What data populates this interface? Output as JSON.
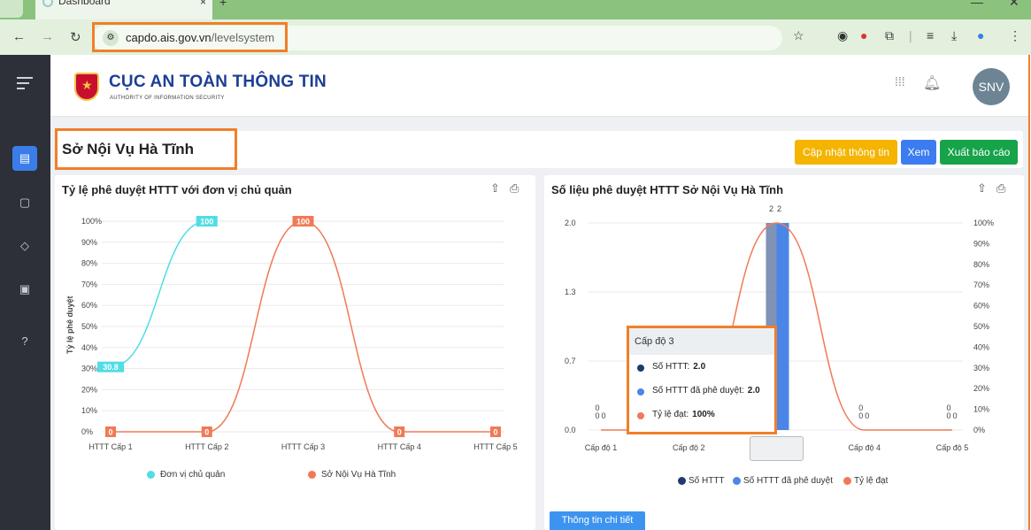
{
  "browser": {
    "tab_title": "Dashboard",
    "tab_close": "×",
    "new_tab": "+",
    "url_host": "capdo.ais.gov.vn",
    "url_path": "/levelsystem"
  },
  "header": {
    "org_name": "CỤC AN TOÀN THÔNG TIN",
    "org_sub": "AUTHORITY OF INFORMATION SECURITY",
    "avatar": "SNV"
  },
  "page": {
    "title": "Sở Nội Vụ Hà Tĩnh",
    "buttons": {
      "update": "Cập nhật thông tin",
      "view": "Xem",
      "export": "Xuất báo cáo"
    },
    "detail_button": "Thông tin chi tiết"
  },
  "left_chart_title": "Tỷ lệ phê duyệt HTTT với đơn vị chủ quản",
  "right_chart_title": "Số liệu phê duyệt HTTT Sở Nội Vụ Hà Tĩnh",
  "tooltip": {
    "title": "Cấp độ 3",
    "rows": [
      {
        "label": "Số HTTT:",
        "value": "2.0"
      },
      {
        "label": "Số HTTT đã phê duyệt:",
        "value": "2.0"
      },
      {
        "label": "Tỷ lệ đạt:",
        "value": "100%"
      }
    ]
  },
  "chart_data": [
    {
      "type": "line",
      "title": "Tỷ lệ phê duyệt HTTT với đơn vị chủ quản",
      "ylabel": "Tỷ lệ phê duyệt",
      "categories": [
        "HTTT Cấp 1",
        "HTTT Cấp 2",
        "HTTT Cấp 3",
        "HTTT Cấp 4",
        "HTTT Cấp 5"
      ],
      "yticks": [
        "0%",
        "10%",
        "20%",
        "30%",
        "40%",
        "50%",
        "60%",
        "70%",
        "80%",
        "90%",
        "100%"
      ],
      "ylim": [
        0,
        100
      ],
      "series": [
        {
          "name": "Đơn vị chủ quản",
          "color": "#4fdde6",
          "values": [
            30.8,
            100,
            null,
            null,
            null
          ],
          "labels": [
            "30.8",
            "100",
            "",
            "",
            ""
          ]
        },
        {
          "name": "Sở Nội Vụ Hà Tĩnh",
          "color": "#f07a55",
          "values": [
            0,
            0,
            100,
            0,
            0
          ],
          "labels": [
            "0",
            "0",
            "100",
            "0",
            "0"
          ]
        }
      ],
      "legend": "bottom"
    },
    {
      "type": "bar",
      "title": "Số liệu phê duyệt HTTT Sở Nội Vụ Hà Tĩnh",
      "categories": [
        "Cấp độ 1",
        "Cấp độ 2",
        "Cấp độ 3",
        "Cấp độ 4",
        "Cấp độ 5"
      ],
      "left_yticks": [
        "0.0",
        "0.7",
        "1.3",
        "2.0"
      ],
      "right_yticks": [
        "0%",
        "10%",
        "20%",
        "30%",
        "40%",
        "50%",
        "60%",
        "70%",
        "80%",
        "90%",
        "100%"
      ],
      "ylim": [
        0,
        2
      ],
      "series": [
        {
          "name": "Số HTTT",
          "color": "#1e3a6e",
          "values": [
            0,
            0,
            2,
            0,
            0
          ]
        },
        {
          "name": "Số HTTT đã phê duyệt",
          "color": "#4a86e8",
          "values": [
            0,
            0,
            2,
            0,
            0
          ]
        },
        {
          "name": "Tỷ lệ đạt",
          "color": "#f07a55",
          "type": "line",
          "values": [
            0,
            0,
            100,
            0,
            0
          ]
        }
      ],
      "top_label": "2",
      "legend": "bottom"
    }
  ]
}
